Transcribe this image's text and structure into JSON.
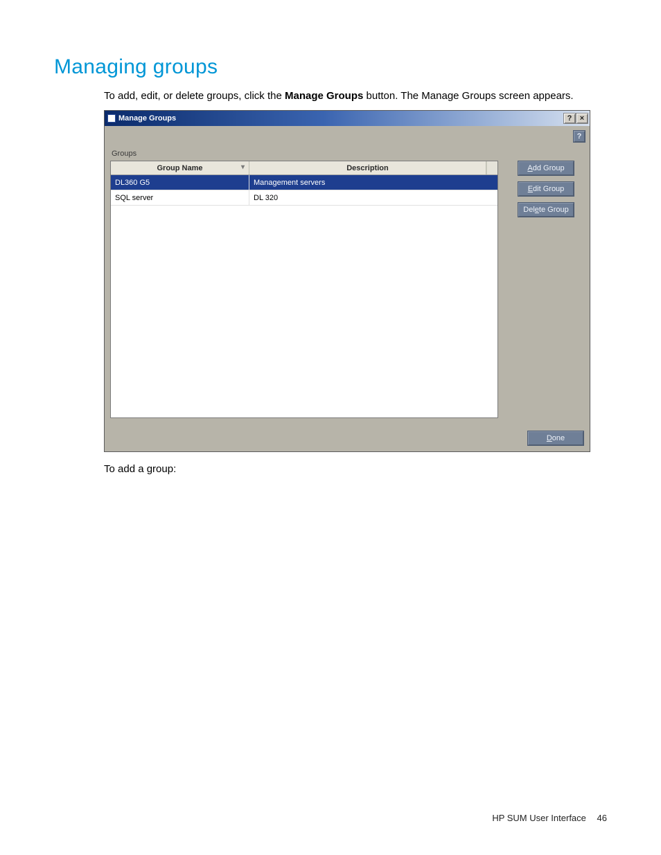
{
  "heading": "Managing groups",
  "intro_before": "To add, edit, or delete groups, click the ",
  "intro_bold": "Manage Groups",
  "intro_after": " button. The Manage Groups screen appears.",
  "dialog": {
    "title": "Manage Groups",
    "help_btn": "?",
    "close_btn": "×",
    "mini_help": "?",
    "section_label": "Groups",
    "columns": {
      "name": "Group Name",
      "desc": "Description"
    },
    "sort_indicator": "▾",
    "rows": [
      {
        "name": "DL360 G5",
        "desc": "Management servers",
        "selected": true
      },
      {
        "name": "SQL server",
        "desc": "DL 320",
        "selected": false
      }
    ],
    "buttons": {
      "add_prefix": "A",
      "add_rest": "dd Group",
      "edit_prefix": "E",
      "edit_rest": "dit Group",
      "delete_prefix": "Del",
      "delete_u": "e",
      "delete_rest": "te Group",
      "done_prefix": "D",
      "done_rest": "one"
    }
  },
  "after_text": "To add a group:",
  "footer": {
    "label": "HP SUM User Interface",
    "page": "46"
  }
}
